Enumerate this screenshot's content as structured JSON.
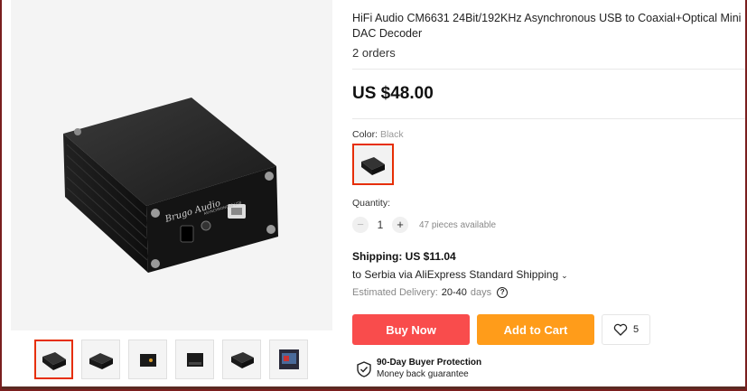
{
  "product": {
    "title": "HiFi Audio CM6631 24Bit/192KHz Asynchronous USB to Coaxial+Optical Mini DAC Decoder",
    "orders": "2 orders",
    "price": "US $48.00"
  },
  "color": {
    "label": "Color:",
    "selected": "Black"
  },
  "quantity": {
    "label": "Quantity:",
    "minus": "−",
    "plus": "+",
    "value": "1",
    "available": "47 pieces available"
  },
  "shipping": {
    "cost": "Shipping: US $11.04",
    "destination": "to Serbia via AliExpress Standard Shipping",
    "chevron": "⌄",
    "delivery_label": "Estimated Delivery:",
    "delivery_days": "20-40",
    "delivery_unit": "days",
    "help_icon": "?"
  },
  "actions": {
    "buy_now": "Buy Now",
    "add_to_cart": "Add to Cart",
    "wishlist_count": "5"
  },
  "protection": {
    "title": "90-Day Buyer Protection",
    "subtitle": "Money back guarantee"
  },
  "gallery": {
    "thumbnail_count": 6,
    "active_index": 0
  },
  "colors": {
    "accent": "#e62e04",
    "buy_now": "#f94c4c",
    "add_to_cart": "#ff9c1a"
  }
}
